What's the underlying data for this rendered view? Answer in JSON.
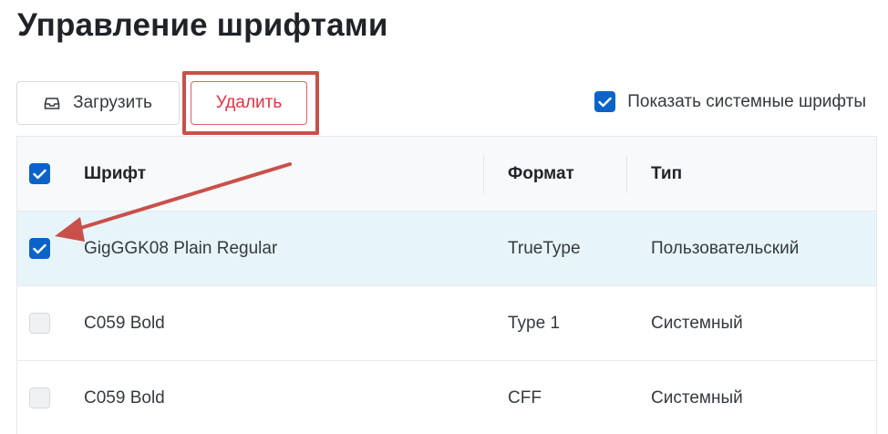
{
  "page": {
    "title": "Управление шрифтами"
  },
  "toolbar": {
    "upload_label": "Загрузить",
    "upload_icon": "upload-tray-icon",
    "delete_label": "Удалить",
    "show_system_label": "Показать системные шрифты",
    "show_system_checked": true
  },
  "table": {
    "headers": {
      "name": "Шрифт",
      "format": "Формат",
      "type": "Тип"
    },
    "select_all_checked": true,
    "rows": [
      {
        "name": "GigGGK08 Plain Regular",
        "format": "TrueType",
        "type": "Пользовательский",
        "checked": true
      },
      {
        "name": "C059 Bold",
        "format": "Type 1",
        "type": "Системный",
        "checked": false
      },
      {
        "name": "C059 Bold",
        "format": "CFF",
        "type": "Системный",
        "checked": false
      }
    ]
  },
  "colors": {
    "accent": "#0b63c9",
    "danger": "#dc3545",
    "annotation": "#c9504a",
    "selected_row": "#e7f5fb"
  }
}
